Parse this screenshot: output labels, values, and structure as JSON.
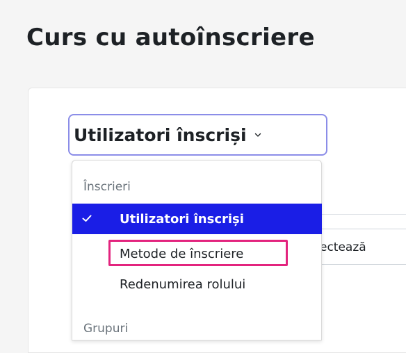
{
  "header": {
    "title": "Curs cu autoînscriere"
  },
  "selector": {
    "label": "Utilizatori înscriși"
  },
  "background": {
    "select_text": "ectează"
  },
  "menu": {
    "groups": [
      {
        "heading": "Înscrieri",
        "items": [
          {
            "label": "Utilizatori înscriși",
            "active": true
          },
          {
            "label": "Metode de înscriere",
            "active": false,
            "highlighted": true
          },
          {
            "label": "Redenumirea rolului",
            "active": false
          }
        ]
      },
      {
        "heading": "Grupuri",
        "items": []
      }
    ]
  },
  "colors": {
    "active_bg": "#1a1ee6",
    "highlight": "#e3247e",
    "focus_ring": "#8b8de8"
  },
  "icons": {
    "check": "check-icon",
    "chevron": "chevron-down-icon"
  }
}
